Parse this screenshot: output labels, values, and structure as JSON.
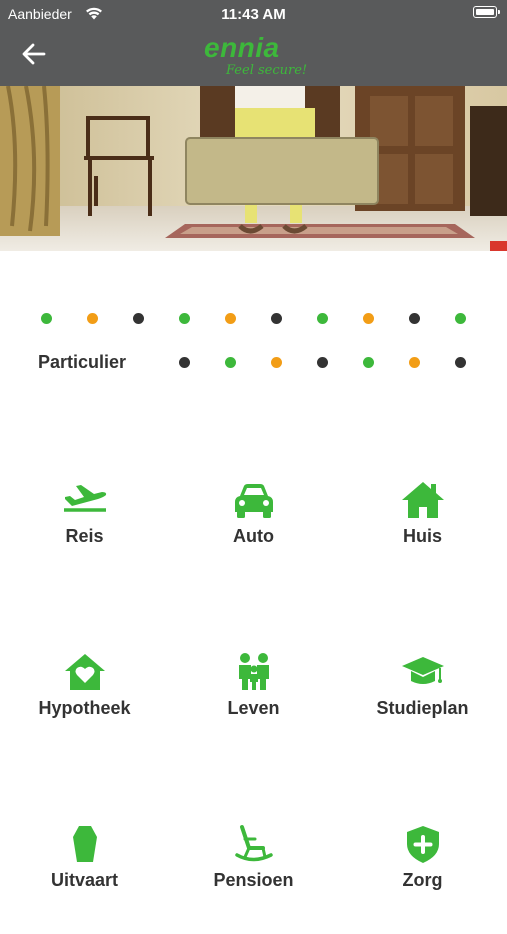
{
  "status": {
    "carrier": "Aanbieder",
    "time": "11:43 AM"
  },
  "header": {
    "brand": "ennia",
    "slogan": "Feel secure!"
  },
  "colors": {
    "green": "#3db83b",
    "orange": "#f29d16",
    "dark": "#333333",
    "bar": "#595a5b"
  },
  "section": {
    "title": "Particulier"
  },
  "dots": {
    "row1": [
      "green",
      "orange",
      "dark",
      "green",
      "orange",
      "dark",
      "green",
      "orange",
      "dark",
      "green"
    ],
    "row2": [
      "dark",
      "green",
      "orange",
      "dark",
      "green",
      "orange",
      "dark"
    ]
  },
  "tiles": [
    {
      "label": "Reis",
      "icon": "airplane-icon"
    },
    {
      "label": "Auto",
      "icon": "car-icon"
    },
    {
      "label": "Huis",
      "icon": "house-icon"
    },
    {
      "label": "Hypotheek",
      "icon": "house-heart-icon"
    },
    {
      "label": "Leven",
      "icon": "family-icon"
    },
    {
      "label": "Studieplan",
      "icon": "graduation-cap-icon"
    },
    {
      "label": "Uitvaart",
      "icon": "coffin-icon"
    },
    {
      "label": "Pensioen",
      "icon": "rocking-chair-icon"
    },
    {
      "label": "Zorg",
      "icon": "shield-plus-icon"
    }
  ]
}
